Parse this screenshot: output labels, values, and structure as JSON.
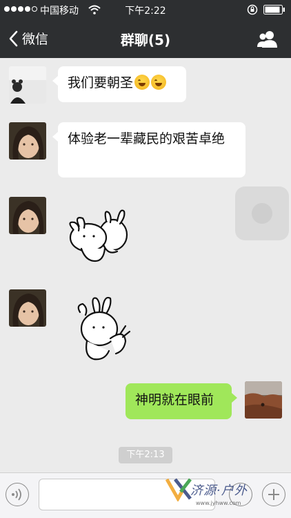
{
  "status_bar": {
    "carrier": "中国移动",
    "time": "下午2:22"
  },
  "nav": {
    "back_label": "微信",
    "title": "群聊(5)"
  },
  "messages": [
    {
      "side": "left",
      "type": "text",
      "text": "我们要朝圣"
    },
    {
      "side": "left",
      "type": "text",
      "text": "体验老一辈藏民的艰苦卓绝"
    },
    {
      "side": "left",
      "type": "sticker",
      "icon": "rabbit-hug-sticker"
    },
    {
      "side": "left",
      "type": "sticker",
      "icon": "rabbit-wave-sticker"
    },
    {
      "side": "right",
      "type": "text",
      "text": "神明就在眼前"
    }
  ],
  "timestamp": "下午2:13",
  "input": {
    "value": "",
    "placeholder": ""
  },
  "watermark": {
    "text": "济源·户外",
    "url": "www.jyhww.com"
  },
  "colors": {
    "navbar": "#2d2f31",
    "background": "#ebebeb",
    "sent_bubble": "#a0e75a",
    "received_bubble": "#ffffff"
  }
}
